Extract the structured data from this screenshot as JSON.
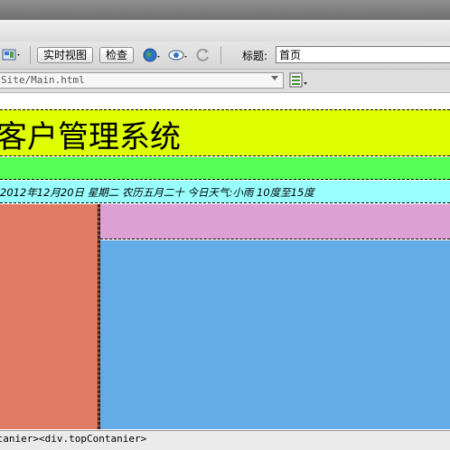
{
  "toolbar": {
    "live_view_label": "实时视图",
    "inspect_label": "检查",
    "title_label": "标题:",
    "title_value": "首页"
  },
  "address": {
    "path": "Site/Main.html"
  },
  "page": {
    "banner_title": "客户管理系统",
    "info_line": "2012年12月20日  星期二  农历五月二十  今日天气:小雨  10度至15度"
  },
  "colors": {
    "banner": "#dfff00",
    "green_bar": "#55ff55",
    "info_bar": "#99ffff",
    "left_column": "#e07b63",
    "pink_box": "#dda0d3",
    "blue_box": "#64ace8"
  },
  "status": {
    "tag_path": "ntanier><div.topContanier>"
  },
  "icons": [
    "layout-icon",
    "globe-icon",
    "preview-eye-icon",
    "refresh-icon",
    "options-icon"
  ]
}
